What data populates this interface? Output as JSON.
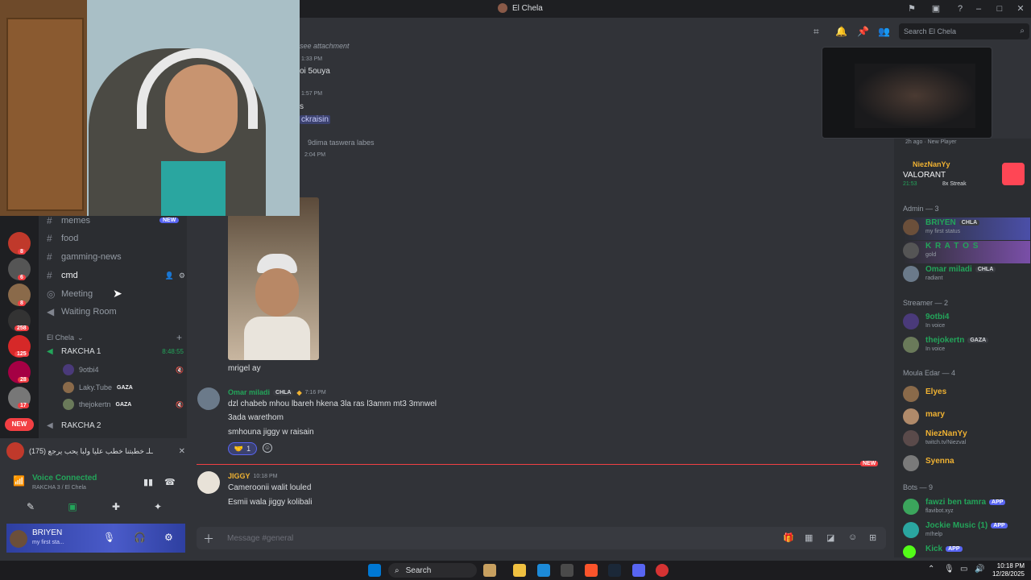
{
  "window": {
    "title": "El Chela"
  },
  "header": {
    "search_placeholder": "Search El Chela"
  },
  "chat": {
    "lines": [
      {
        "text": "see attachment",
        "kind": "sys"
      },
      {
        "text": "1:33 PM",
        "kind": "sys"
      },
      {
        "text": "oi 5ouya",
        "kind": "txt"
      },
      {
        "text": "1:57 PM",
        "kind": "sys"
      },
      {
        "text": "s",
        "kind": "txt"
      },
      {
        "text": "ckraisin",
        "kind": "mention"
      },
      {
        "text": "9dima taswera labes",
        "kind": "sys"
      },
      {
        "text": "2:04 PM",
        "kind": "sys"
      }
    ],
    "caption": "mrigel ay",
    "messages": [
      {
        "author": "Omar miladi",
        "tag": "CHLA",
        "time": "7:16 PM",
        "color": "#23a55a",
        "lines": [
          "dzl chabeb mhou lbareh hkena 3la ras l3amm mt3 3mnwel",
          "3ada warethom",
          "smhouna jiggy w raisain"
        ],
        "reaction_count": "1"
      },
      {
        "author": "JIGGY",
        "time": "10:18 PM",
        "color": "#f0b232",
        "lines": [
          "Cameroonii walit louled",
          "Esmii wala jiggy kolibali"
        ]
      }
    ],
    "new_marker": "NEW",
    "composer_placeholder": "Message #general"
  },
  "sidebar": {
    "new_badge": "NEW",
    "channels": [
      {
        "label": "memes",
        "icon": "#"
      },
      {
        "label": "food",
        "icon": "#"
      },
      {
        "label": "gamming-news",
        "icon": "#"
      },
      {
        "label": "cmd",
        "icon": "#",
        "active": true
      },
      {
        "label": "Meeting",
        "icon": "◎"
      },
      {
        "label": "Waiting Room",
        "icon": "◀"
      }
    ],
    "category": "El Chela",
    "voice_channels": [
      {
        "label": "RAKCHA 1",
        "time": "8:48:55"
      },
      {
        "label": "RAKCHA 2"
      }
    ],
    "voice_users": [
      {
        "name": "9otbi4",
        "tag": ""
      },
      {
        "name": "Laky.Tube",
        "tag": "GAZA"
      },
      {
        "name": "thejokertn",
        "tag": "GAZA"
      }
    ],
    "activity_text": "ـلـ خطبتنا خطب عليا ولبا يحب يرجع (175)",
    "voice_status": "Voice Connected",
    "voice_sub": "RAKCHA 3 / El Chela",
    "user_name": "BRIYEN",
    "user_status": "my first sta..."
  },
  "rail_badges": [
    "8",
    "6",
    "8",
    "258",
    "125",
    "28",
    "17",
    "NEW"
  ],
  "members": {
    "game_card": {
      "user": "NiezNanYy",
      "game": "VALORANT",
      "time": "21:53",
      "streak": "8x Streak",
      "card_info": "2h ago · New Player"
    },
    "groups": [
      {
        "title": "Admin — 3",
        "items": [
          {
            "name": "BRIYEN",
            "tag": "CHLA",
            "sub": "my first status",
            "color": "#23a55a"
          },
          {
            "name": "K R A T O S",
            "tag": "",
            "sub": "gold",
            "color": "#23a55a"
          },
          {
            "name": "Omar miladi",
            "tag": "CHLA",
            "sub": "radiant",
            "color": "#23a55a"
          }
        ]
      },
      {
        "title": "Streamer — 2",
        "items": [
          {
            "name": "9otbi4",
            "tag": "",
            "sub": "In voice",
            "color": "#23a55a"
          },
          {
            "name": "thejokertn",
            "tag": "GAZA",
            "sub": "In voice",
            "color": "#23a55a"
          }
        ]
      },
      {
        "title": "Moula Edar — 4",
        "items": [
          {
            "name": "Elyes",
            "tag": "",
            "sub": "",
            "color": "#f0b232"
          },
          {
            "name": "mary",
            "tag": "",
            "sub": "",
            "color": "#f0b232"
          },
          {
            "name": "NiezNanYy",
            "tag": "",
            "sub": "twitch.tv/Niezval",
            "color": "#f0b232"
          },
          {
            "name": "Syenna",
            "tag": "",
            "sub": "",
            "color": "#f0b232"
          }
        ]
      },
      {
        "title": "Bots — 9",
        "items": [
          {
            "name": "fawzi ben tamra",
            "tag": "APP",
            "sub": "flavibot.xyz",
            "color": "#23a55a"
          },
          {
            "name": "Jockie Music (1)",
            "tag": "APP",
            "sub": "m!help",
            "color": "#23a55a"
          },
          {
            "name": "Kick",
            "tag": "APP",
            "sub": "",
            "color": "#23a55a"
          }
        ]
      }
    ]
  },
  "taskbar": {
    "search_label": "Search",
    "time": "10:18 PM",
    "date": "12/28/2025"
  }
}
